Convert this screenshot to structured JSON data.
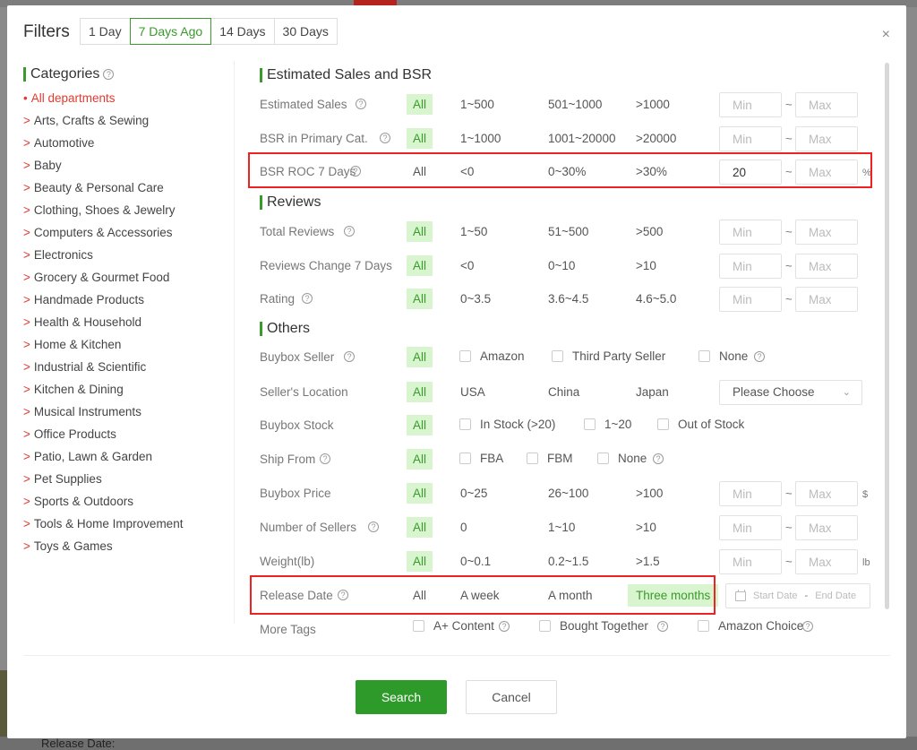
{
  "background": {
    "bottom_text": "Release Date:"
  },
  "modal": {
    "title": "Filters",
    "close": "×",
    "range_tabs": [
      "1 Day",
      "7 Days Ago",
      "14 Days",
      "30 Days"
    ],
    "active_range_tab": "7 Days Ago"
  },
  "categories": {
    "title": "Categories",
    "items": [
      "All departments",
      "Arts, Crafts & Sewing",
      "Automotive",
      "Baby",
      "Beauty & Personal Care",
      "Clothing, Shoes & Jewelry",
      "Computers & Accessories",
      "Electronics",
      "Grocery & Gourmet Food",
      "Handmade Products",
      "Health & Household",
      "Home & Kitchen",
      "Industrial & Scientific",
      "Kitchen & Dining",
      "Musical Instruments",
      "Office Products",
      "Patio, Lawn & Garden",
      "Pet Supplies",
      "Sports & Outdoors",
      "Tools & Home Improvement",
      "Toys & Games"
    ]
  },
  "sections": {
    "sales": "Estimated Sales and BSR",
    "reviews": "Reviews",
    "others": "Others"
  },
  "rows": {
    "est_sales": {
      "label": "Estimated Sales",
      "options": [
        "All",
        "1~500",
        "501~1000",
        ">1000"
      ],
      "min": "",
      "max": ""
    },
    "bsr_primary": {
      "label": "BSR in Primary Cat.",
      "options": [
        "All",
        "1~1000",
        "1001~20000",
        ">20000"
      ],
      "min": "",
      "max": ""
    },
    "bsr_roc": {
      "label": "BSR ROC 7 Days",
      "options": [
        "All",
        "<0",
        "0~30%",
        ">30%"
      ],
      "min": "20",
      "max": "",
      "unit": "%"
    },
    "total_reviews": {
      "label": "Total Reviews",
      "options": [
        "All",
        "1~50",
        "51~500",
        ">500"
      ],
      "min": "",
      "max": ""
    },
    "reviews_change": {
      "label": "Reviews Change 7 Days",
      "options": [
        "All",
        "<0",
        "0~10",
        ">10"
      ],
      "min": "",
      "max": ""
    },
    "rating": {
      "label": "Rating",
      "options": [
        "All",
        "0~3.5",
        "3.6~4.5",
        "4.6~5.0"
      ],
      "min": "",
      "max": ""
    },
    "buybox_seller": {
      "label": "Buybox Seller",
      "all": "All",
      "checks": [
        "Amazon",
        "Third Party Seller",
        "None"
      ]
    },
    "seller_location": {
      "label": "Seller's Location",
      "options": [
        "All",
        "USA",
        "China",
        "Japan"
      ],
      "select": "Please Choose"
    },
    "buybox_stock": {
      "label": "Buybox Stock",
      "all": "All",
      "checks": [
        "In Stock (>20)",
        "1~20",
        "Out of Stock"
      ]
    },
    "ship_from": {
      "label": "Ship From",
      "all": "All",
      "checks": [
        "FBA",
        "FBM",
        "None"
      ]
    },
    "buybox_price": {
      "label": "Buybox Price",
      "options": [
        "All",
        "0~25",
        "26~100",
        ">100"
      ],
      "min": "",
      "max": "",
      "unit": "$"
    },
    "num_sellers": {
      "label": "Number of Sellers",
      "options": [
        "All",
        "0",
        "1~10",
        ">10"
      ],
      "min": "",
      "max": ""
    },
    "weight": {
      "label": "Weight(lb)",
      "options": [
        "All",
        "0~0.1",
        "0.2~1.5",
        ">1.5"
      ],
      "min": "",
      "max": "",
      "unit": "lb"
    },
    "release_date": {
      "label": "Release Date",
      "options": [
        "All",
        "A week",
        "A month",
        "Three months"
      ],
      "start_placeholder": "Start Date",
      "end_placeholder": "End Date",
      "sep": "-"
    },
    "more_tags": {
      "label": "More Tags",
      "checks": [
        "A+ Content",
        "Bought Together",
        "Amazon Choice"
      ]
    }
  },
  "placeholders": {
    "min": "Min",
    "max": "Max"
  },
  "symbols": {
    "tilde": "~",
    "help": "?",
    "caret": ">",
    "bullet": "•",
    "chevron": "⌄"
  },
  "buttons": {
    "search": "Search",
    "cancel": "Cancel"
  },
  "colors": {
    "accent": "#3a9a2c",
    "active_bg": "#d9f5cf",
    "category_active": "#e23a2f",
    "highlight_box": "#e22222"
  }
}
